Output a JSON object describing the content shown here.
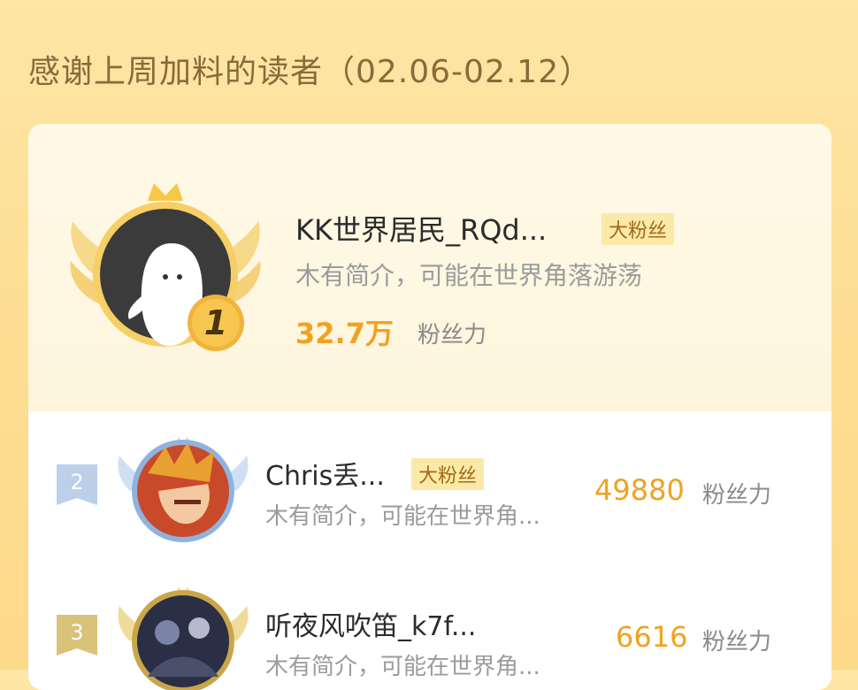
{
  "header": {
    "title": "感谢上周加料的读者（02.06-02.12）"
  },
  "colors": {
    "accent": "#f0a221",
    "badge_bg": "#fbe9a8",
    "badge_text": "#a16b1a"
  },
  "top_reader": {
    "rank": "1",
    "name": "KK世界居民_RQd...",
    "badge": "大粉丝",
    "bio": "木有简介，可能在世界角落游荡",
    "score": "32.7万",
    "unit": "粉丝力"
  },
  "rows": [
    {
      "rank": "2",
      "name": "Chris丢...",
      "badge": "大粉丝",
      "bio": "木有简介，可能在世界角...",
      "score": "49880",
      "unit": "粉丝力"
    },
    {
      "rank": "3",
      "name": "听夜风吹笛_k7f...",
      "badge": "",
      "bio": "木有简介，可能在世界角...",
      "score": "6616",
      "unit": "粉丝力"
    }
  ]
}
